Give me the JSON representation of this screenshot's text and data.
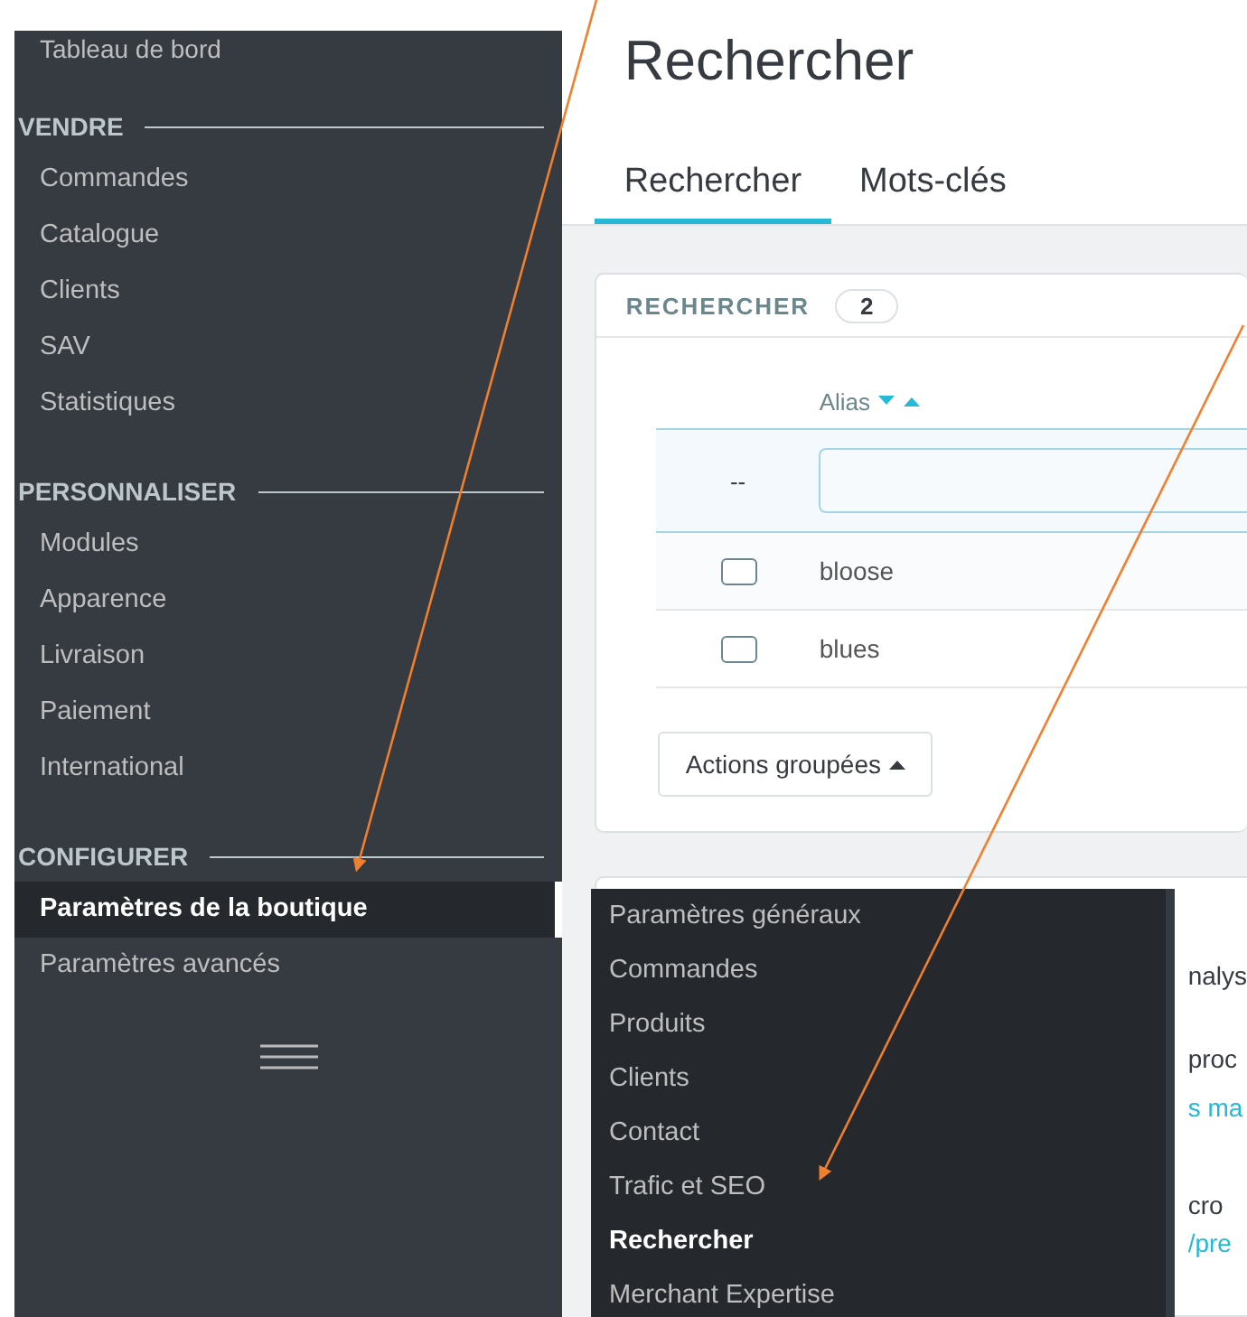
{
  "sidebar": {
    "top_item": "Tableau de bord",
    "sections": [
      {
        "heading": "VENDRE",
        "items": [
          {
            "label": "Commandes",
            "selected": false
          },
          {
            "label": "Catalogue",
            "selected": false
          },
          {
            "label": "Clients",
            "selected": false
          },
          {
            "label": "SAV",
            "selected": false
          },
          {
            "label": "Statistiques",
            "selected": false
          }
        ]
      },
      {
        "heading": "PERSONNALISER",
        "items": [
          {
            "label": "Modules",
            "selected": false
          },
          {
            "label": "Apparence",
            "selected": false
          },
          {
            "label": "Livraison",
            "selected": false
          },
          {
            "label": "Paiement",
            "selected": false
          },
          {
            "label": "International",
            "selected": false
          }
        ]
      },
      {
        "heading": "CONFIGURER",
        "items": [
          {
            "label": "Paramètres de la boutique",
            "selected": true
          },
          {
            "label": "Paramètres avancés",
            "selected": false
          }
        ]
      }
    ]
  },
  "page": {
    "title": "Rechercher",
    "tabs": [
      {
        "label": "Rechercher",
        "selected": true
      },
      {
        "label": "Mots-clés",
        "selected": false
      }
    ]
  },
  "card": {
    "title": "RECHERCHER",
    "count": "2",
    "column": "Alias",
    "filter_placeholder": "--",
    "rows": [
      {
        "alias": "bloose",
        "checked": false
      },
      {
        "alias": "blues",
        "checked": false
      }
    ],
    "bulk_button": "Actions groupées"
  },
  "second_card": {
    "lines": [
      {
        "text": "nalys",
        "kind": "text"
      },
      {
        "text": "proc",
        "kind": "text"
      },
      {
        "text": "s ma",
        "kind": "link"
      },
      {
        "text": "cro",
        "kind": "text"
      },
      {
        "text": "/pre",
        "kind": "link"
      }
    ]
  },
  "submenu": {
    "items": [
      {
        "label": "Paramètres généraux",
        "selected": false
      },
      {
        "label": "Commandes",
        "selected": false
      },
      {
        "label": "Produits",
        "selected": false
      },
      {
        "label": "Clients",
        "selected": false
      },
      {
        "label": "Contact",
        "selected": false
      },
      {
        "label": "Trafic et SEO",
        "selected": false
      },
      {
        "label": "Rechercher",
        "selected": true
      },
      {
        "label": "Merchant Expertise",
        "selected": false
      }
    ]
  }
}
